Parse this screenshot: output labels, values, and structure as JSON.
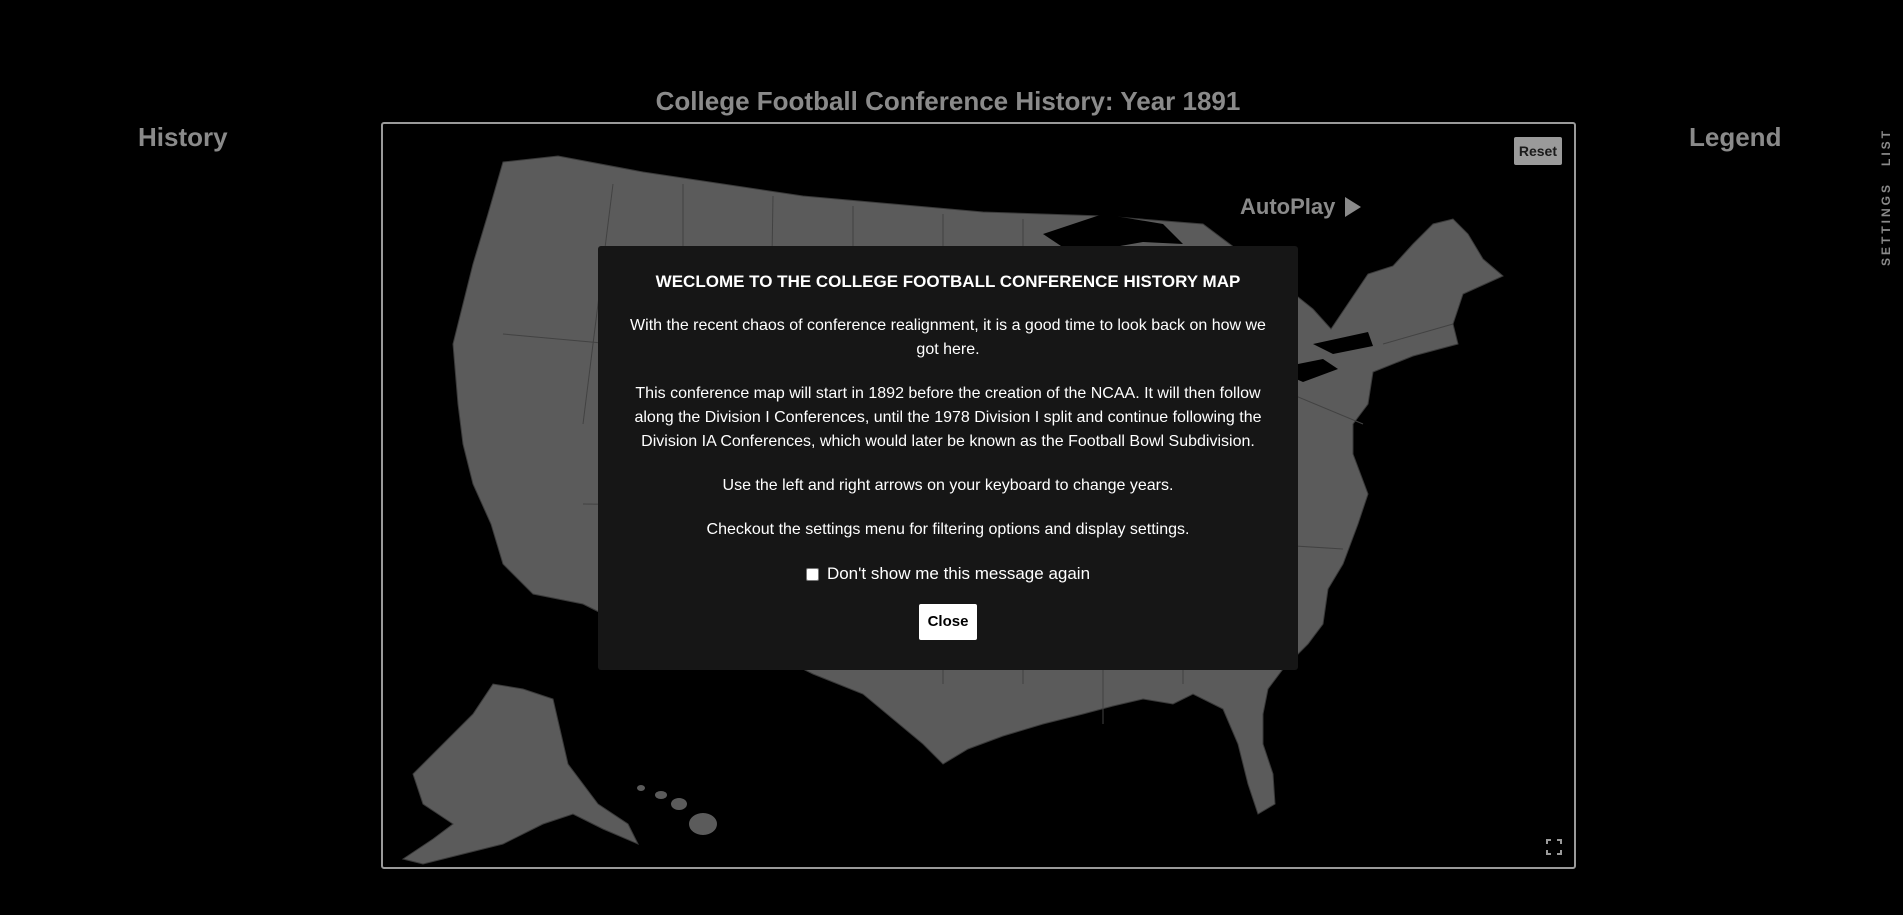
{
  "header": {
    "title": "College Football Conference History: Year 1891"
  },
  "panels": {
    "history_label": "History",
    "legend_label": "Legend"
  },
  "side_tabs": {
    "list_label": "LIST",
    "settings_label": "SETTINGS"
  },
  "map": {
    "reset_label": "Reset",
    "autoplay_label": "AutoPlay",
    "land_color": "#5b5b5b",
    "border_color": "#3a3a3a",
    "icons": {
      "autoplay": "play-icon",
      "fullscreen": "fullscreen-icon"
    }
  },
  "modal": {
    "title": "WECLOME TO THE COLLEGE FOOTBALL CONFERENCE HISTORY MAP",
    "paragraphs": [
      "With the recent chaos of conference realignment, it is a good time to look back on how we got here.",
      "This conference map will start in 1892 before the creation of the NCAA. It will then follow along the Division I Conferences, until the 1978 Division I split and continue following the Division IA Conferences, which would later be known as the Football Bowl Subdivision.",
      "Use the left and right arrows on your keyboard to change years.",
      "Checkout the settings menu for filtering options and display settings."
    ],
    "checkbox_label": "Don't show me this message again",
    "checkbox_checked": false,
    "close_label": "Close"
  }
}
